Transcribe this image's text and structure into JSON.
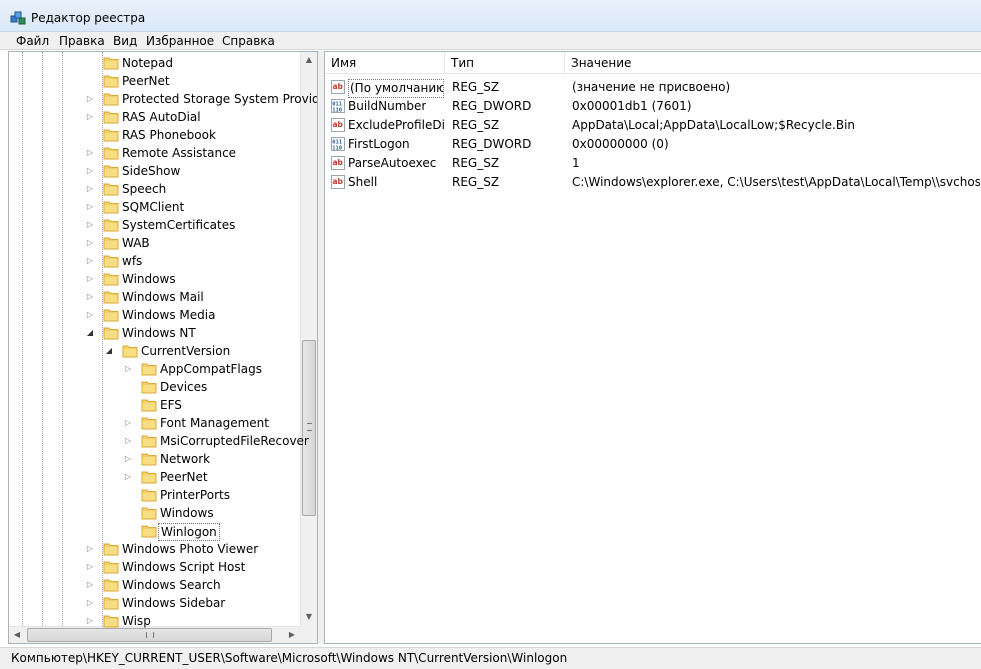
{
  "window": {
    "title": "Редактор реестра"
  },
  "menu": [
    "Файл",
    "Правка",
    "Вид",
    "Избранное",
    "Справка"
  ],
  "tree": {
    "items": [
      {
        "label": "Notepad",
        "level": 2,
        "expander": "none"
      },
      {
        "label": "PeerNet",
        "level": 2,
        "expander": "none"
      },
      {
        "label": "Protected Storage System Provid",
        "level": 2,
        "expander": "collapsed"
      },
      {
        "label": "RAS AutoDial",
        "level": 2,
        "expander": "collapsed"
      },
      {
        "label": "RAS Phonebook",
        "level": 2,
        "expander": "none"
      },
      {
        "label": "Remote Assistance",
        "level": 2,
        "expander": "collapsed"
      },
      {
        "label": "SideShow",
        "level": 2,
        "expander": "collapsed"
      },
      {
        "label": "Speech",
        "level": 2,
        "expander": "collapsed"
      },
      {
        "label": "SQMClient",
        "level": 2,
        "expander": "collapsed"
      },
      {
        "label": "SystemCertificates",
        "level": 2,
        "expander": "collapsed"
      },
      {
        "label": "WAB",
        "level": 2,
        "expander": "collapsed"
      },
      {
        "label": "wfs",
        "level": 2,
        "expander": "collapsed"
      },
      {
        "label": "Windows",
        "level": 2,
        "expander": "collapsed"
      },
      {
        "label": "Windows Mail",
        "level": 2,
        "expander": "collapsed"
      },
      {
        "label": "Windows Media",
        "level": 2,
        "expander": "collapsed"
      },
      {
        "label": "Windows NT",
        "level": 2,
        "expander": "expanded"
      },
      {
        "label": "CurrentVersion",
        "level": 3,
        "expander": "expanded"
      },
      {
        "label": "AppCompatFlags",
        "level": 4,
        "expander": "collapsed"
      },
      {
        "label": "Devices",
        "level": 4,
        "expander": "none"
      },
      {
        "label": "EFS",
        "level": 4,
        "expander": "none"
      },
      {
        "label": "Font Management",
        "level": 4,
        "expander": "collapsed"
      },
      {
        "label": "MsiCorruptedFileRecover",
        "level": 4,
        "expander": "collapsed"
      },
      {
        "label": "Network",
        "level": 4,
        "expander": "collapsed"
      },
      {
        "label": "PeerNet",
        "level": 4,
        "expander": "collapsed"
      },
      {
        "label": "PrinterPorts",
        "level": 4,
        "expander": "none"
      },
      {
        "label": "Windows",
        "level": 4,
        "expander": "none"
      },
      {
        "label": "Winlogon",
        "level": 4,
        "expander": "none",
        "selected": true
      },
      {
        "label": "Windows Photo Viewer",
        "level": 2,
        "expander": "collapsed"
      },
      {
        "label": "Windows Script Host",
        "level": 2,
        "expander": "collapsed"
      },
      {
        "label": "Windows Search",
        "level": 2,
        "expander": "collapsed"
      },
      {
        "label": "Windows Sidebar",
        "level": 2,
        "expander": "collapsed"
      },
      {
        "label": "Wisp",
        "level": 2,
        "expander": "collapsed"
      }
    ]
  },
  "values": {
    "columns": [
      "Имя",
      "Тип",
      "Значение"
    ],
    "rows": [
      {
        "icon": "string-value-icon",
        "name": "(По умолчанию)",
        "type": "REG_SZ",
        "data": "(значение не присвоено)"
      },
      {
        "icon": "binary-value-icon",
        "name": "BuildNumber",
        "type": "REG_DWORD",
        "data": "0x00001db1 (7601)"
      },
      {
        "icon": "string-value-icon",
        "name": "ExcludeProfileDirs",
        "type": "REG_SZ",
        "data": "AppData\\Local;AppData\\LocalLow;$Recycle.Bin"
      },
      {
        "icon": "binary-value-icon",
        "name": "FirstLogon",
        "type": "REG_DWORD",
        "data": "0x00000000 (0)"
      },
      {
        "icon": "string-value-icon",
        "name": "ParseAutoexec",
        "type": "REG_SZ",
        "data": "1"
      },
      {
        "icon": "string-value-icon",
        "name": "Shell",
        "type": "REG_SZ",
        "data": "C:\\Windows\\explorer.exe, C:\\Users\\test\\AppData\\Local\\Temp\\\\svchost.exe..."
      }
    ]
  },
  "status": {
    "path": "Компьютер\\HKEY_CURRENT_USER\\Software\\Microsoft\\Windows NT\\CurrentVersion\\Winlogon"
  },
  "colors": {
    "folder": "#f3d06a",
    "folder_dark": "#d9a93a",
    "string_icon": "#c0392b",
    "binary_icon": "#2c5aa0"
  }
}
